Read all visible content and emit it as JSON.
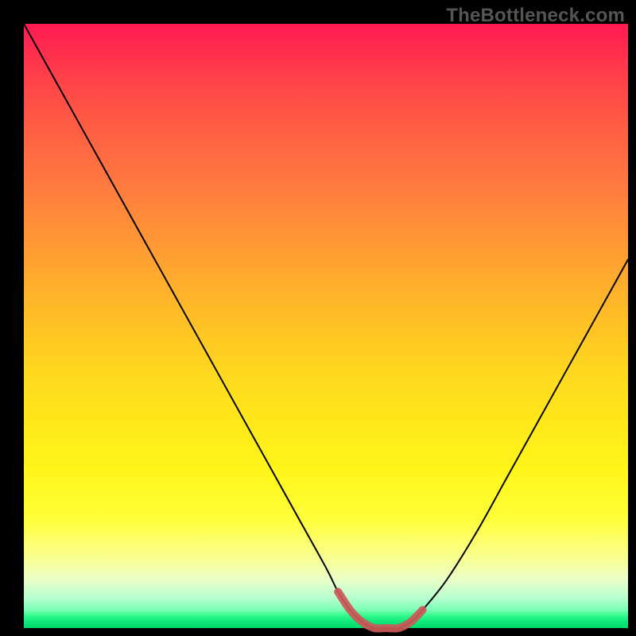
{
  "watermark": {
    "text": "TheBottleneck.com"
  },
  "chart_data": {
    "type": "line",
    "title": "",
    "xlabel": "",
    "ylabel": "",
    "xlim": [
      0,
      100
    ],
    "ylim": [
      0,
      100
    ],
    "x": [
      0,
      5,
      10,
      15,
      20,
      25,
      30,
      35,
      40,
      45,
      50,
      52,
      54,
      56,
      58,
      60,
      62,
      64,
      66,
      70,
      75,
      80,
      85,
      90,
      95,
      100
    ],
    "values": [
      100,
      91,
      82,
      73,
      64,
      55,
      46,
      37,
      28,
      19,
      10,
      6,
      3,
      1,
      0,
      0,
      0,
      1,
      3,
      8,
      16,
      25,
      34,
      43,
      52,
      61
    ],
    "highlight_range_x": [
      52,
      66
    ],
    "series": [
      {
        "name": "bottleneck-curve",
        "x_key": "x",
        "y_key": "values"
      }
    ],
    "colors": {
      "curve": "#000000",
      "highlight": "#cc5858",
      "gradient_top": "#ff1a52",
      "gradient_bottom": "#00db6a"
    }
  }
}
